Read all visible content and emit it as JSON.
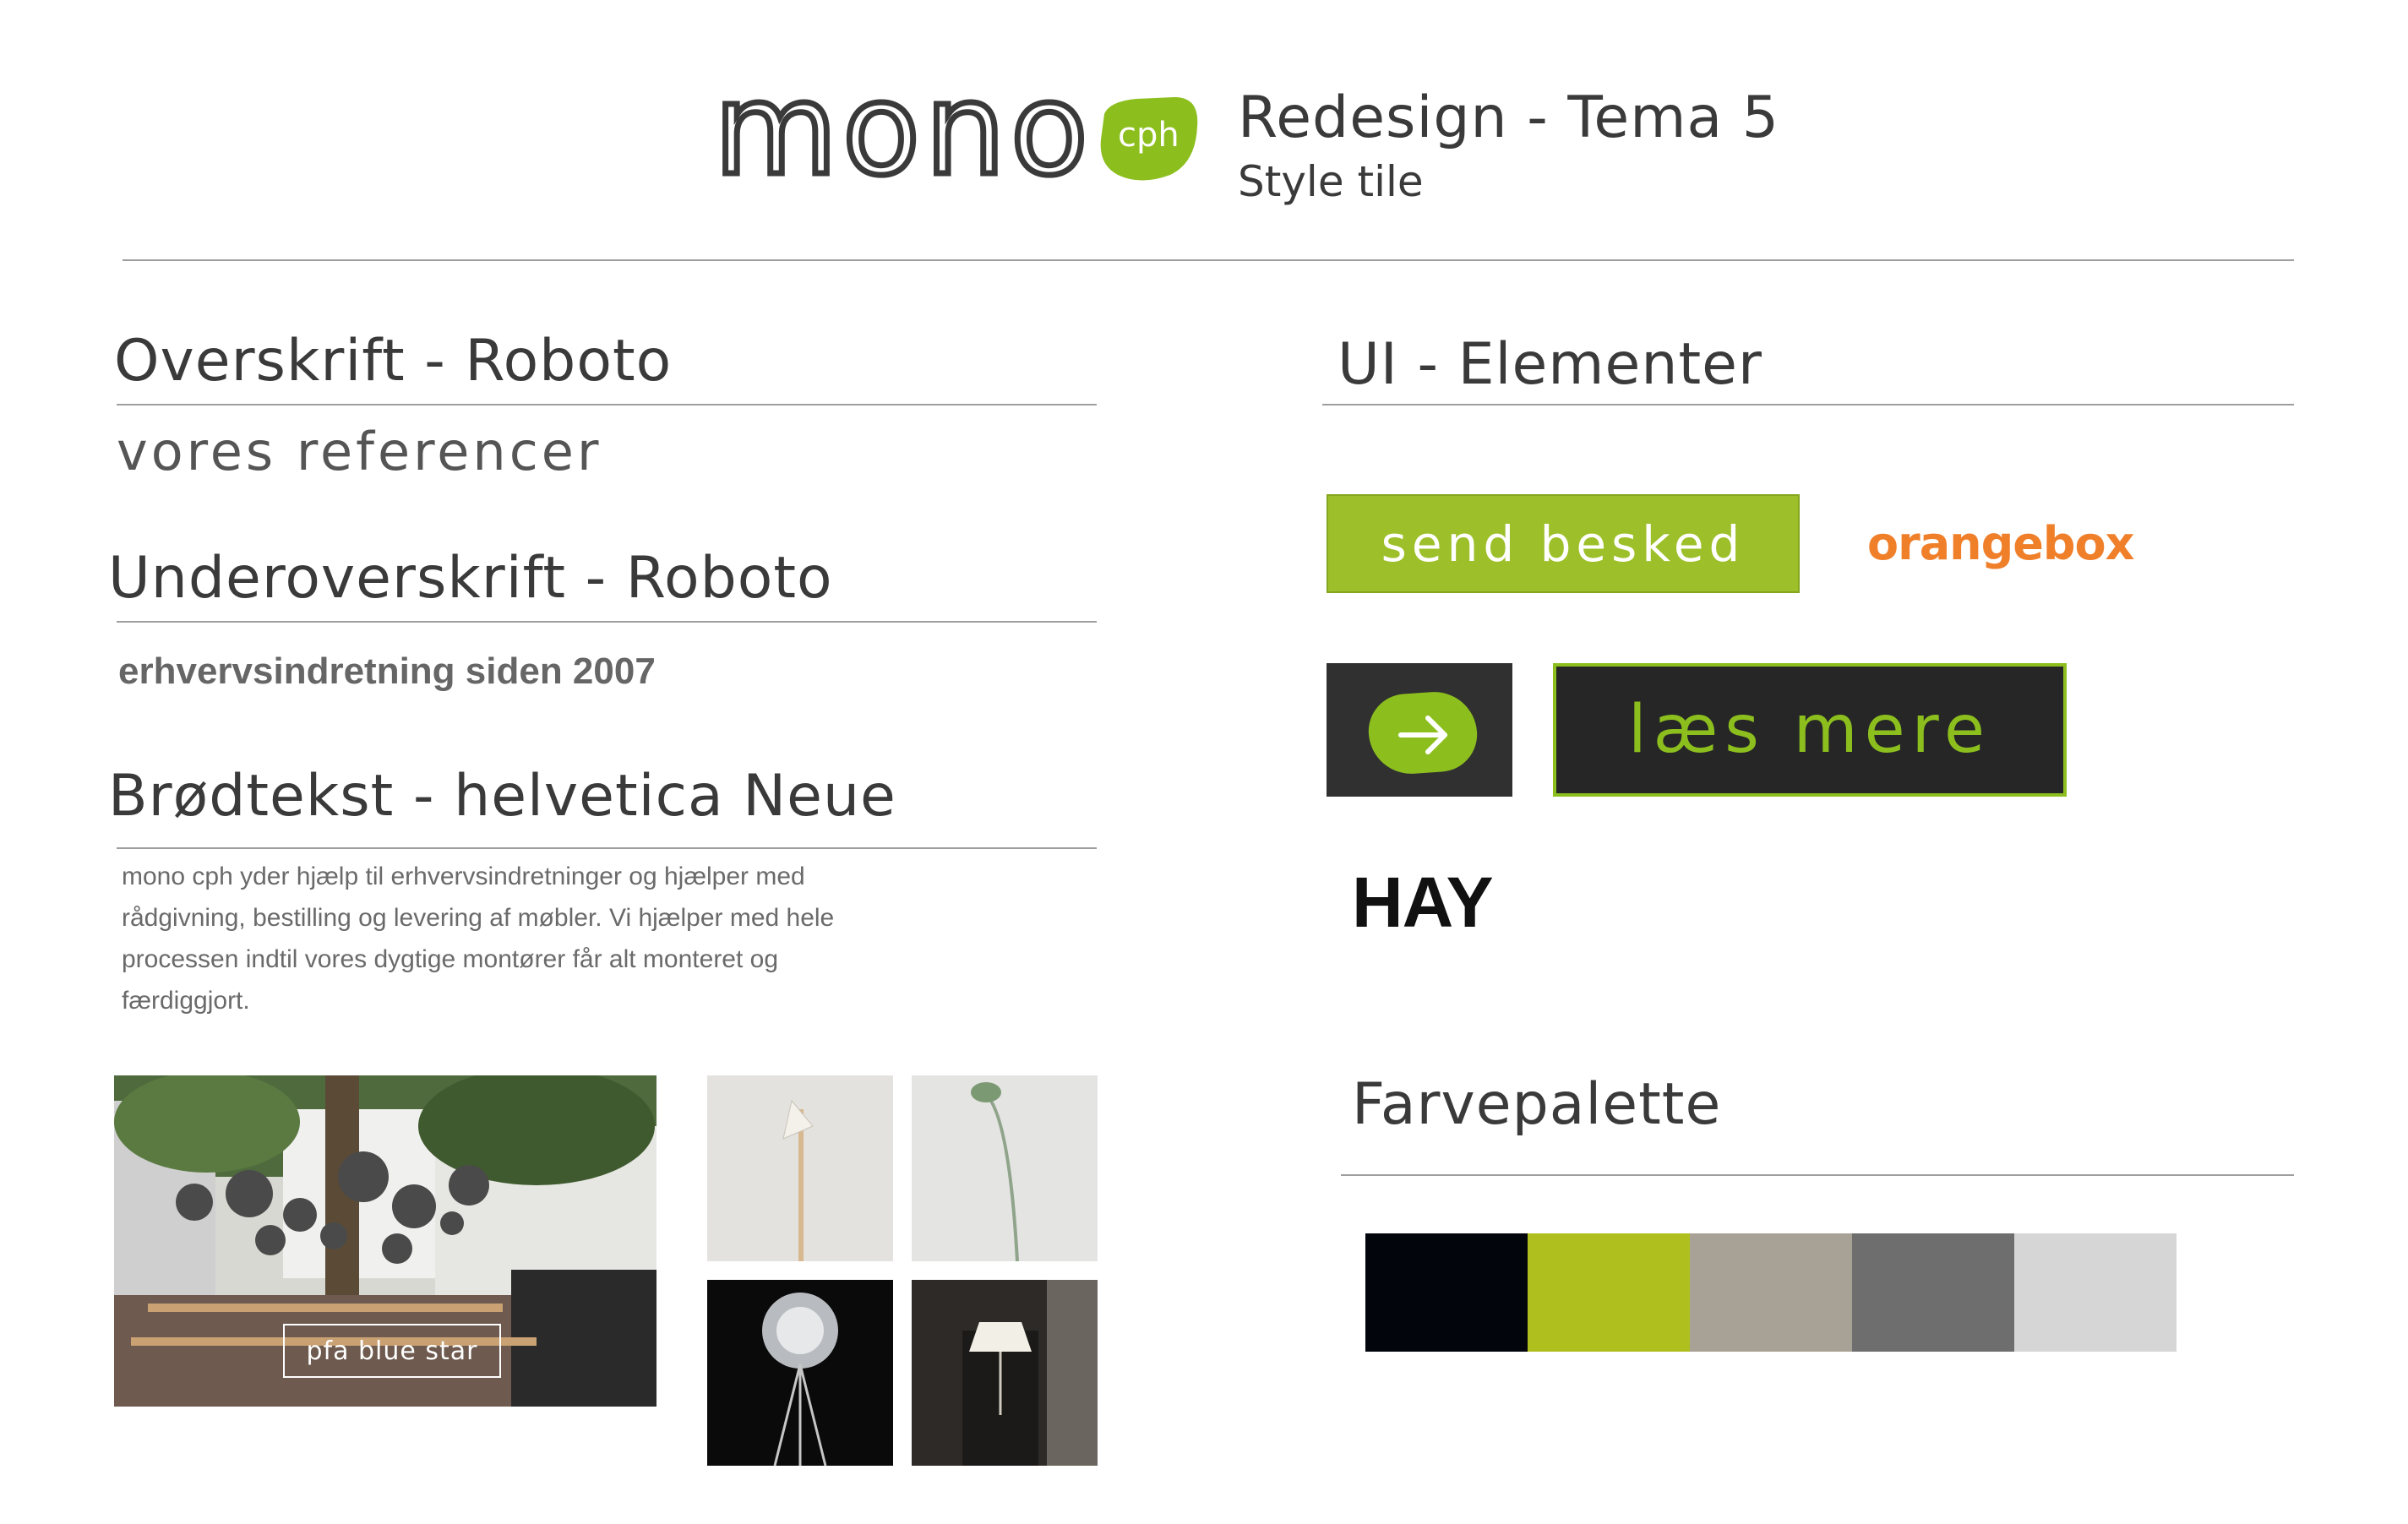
{
  "header": {
    "logo_text": "mono",
    "logo_badge": "cph",
    "title": "Redesign - Tema 5",
    "subtitle": "Style tile"
  },
  "typography": {
    "heading_section": "Overskrift - Roboto",
    "heading_sample": "vores referencer",
    "subheading_section": "Underoverskrift - Roboto",
    "subheading_sample": "erhvervsindretning siden 2007",
    "body_section": "Brødtekst - helvetica Neue",
    "body_lines": [
      "mono cph yder hjælp til erhvervsindretninger og hjælper med",
      "rådgivning, bestilling og levering af møbler. Vi hjælper med hele",
      "processen indtil vores dygtige montører får alt monteret og",
      "færdiggjort."
    ]
  },
  "photos": {
    "main_caption": "pfa blue star"
  },
  "ui_elements": {
    "section": "UI - Elementer",
    "send_button": "send besked",
    "brand_orangebox": "orangebox",
    "read_more_button": "læs mere",
    "brand_hay": "HAY"
  },
  "palette": {
    "section": "Farvepalette",
    "colors": [
      "#03050d",
      "#aebf1e",
      "#a8a196",
      "#6e6e6e",
      "#d6d6d6"
    ]
  }
}
